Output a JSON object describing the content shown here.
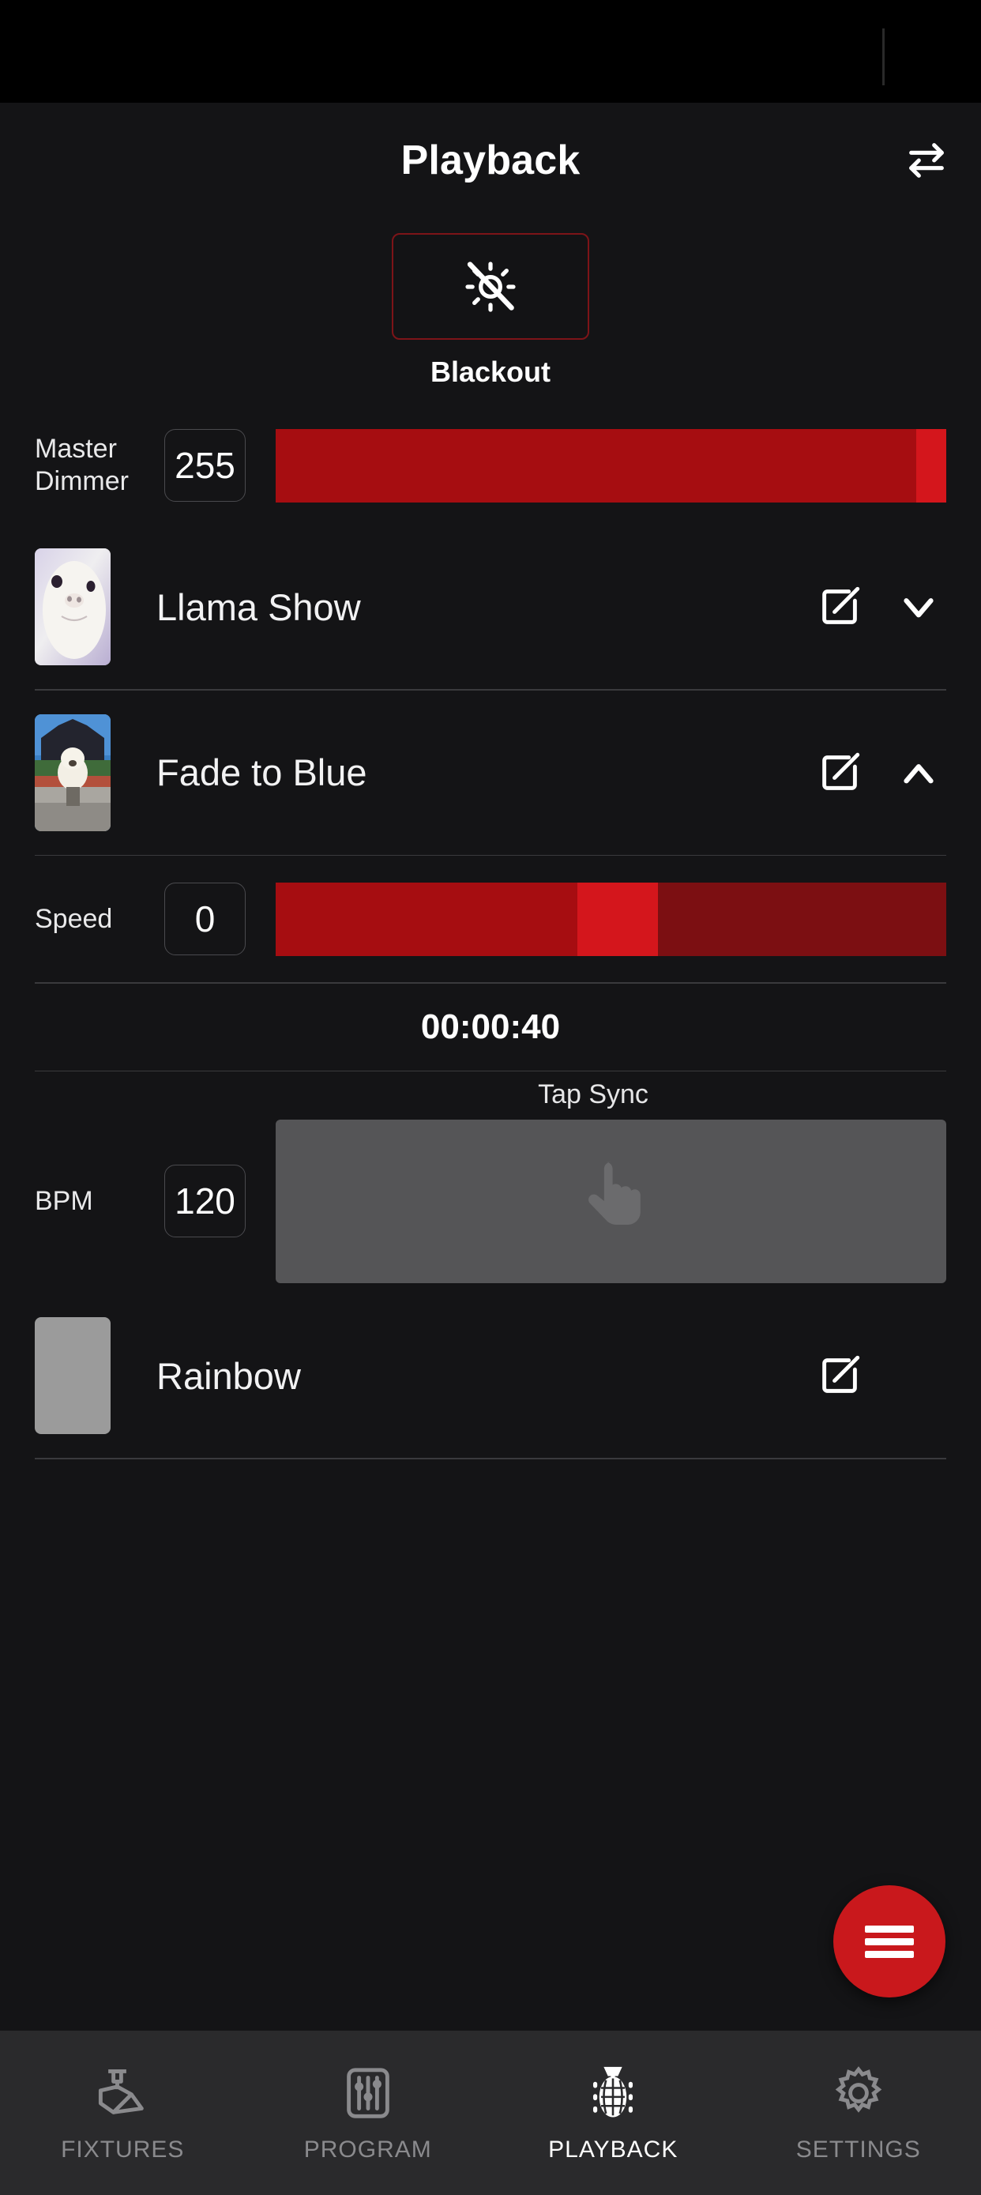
{
  "header": {
    "title": "Playback",
    "swap_icon": "swap-horizontal-icon"
  },
  "blackout": {
    "label": "Blackout",
    "icon": "sun-off-icon",
    "border_color": "#7d1418"
  },
  "master_dimmer": {
    "label": "Master\nDimmer",
    "label_line1": "Master",
    "label_line2": "Dimmer",
    "value": "255",
    "fill_percent": 95.5,
    "thumb_percent": 95.5,
    "fill_color": "#a60d11",
    "thumb_color": "#d4161c",
    "track_color": "#7c0f12"
  },
  "scenes": [
    {
      "name": "Llama Show",
      "edit_icon": "edit-pencil-icon",
      "chevron": "chevron-down-icon",
      "thumbnail": "llama-face-thumbnail"
    },
    {
      "name": "Fade to Blue",
      "edit_icon": "edit-pencil-icon",
      "chevron": "chevron-up-icon",
      "thumbnail": "dog-building-thumbnail"
    }
  ],
  "speed": {
    "label": "Speed",
    "value": "0",
    "fill_percent": 45.0,
    "thumb_percent": 45.0,
    "thumb_width_percent": 12.0
  },
  "timer": {
    "value": "00:00:40"
  },
  "bpm": {
    "label": "BPM",
    "value": "120",
    "tap_sync_label": "Tap Sync",
    "tap_icon": "tap-finger-icon",
    "tap_button_color": "#555557"
  },
  "rainbow_scene": {
    "name": "Rainbow",
    "edit_icon": "edit-pencil-icon",
    "thumbnail": "gray-swatch-thumbnail"
  },
  "fab": {
    "icon": "hamburger-menu-icon",
    "color": "#c9181c"
  },
  "bottom_nav": {
    "items": [
      {
        "label": "FIXTURES",
        "icon": "moving-head-light-icon",
        "active": false
      },
      {
        "label": "PROGRAM",
        "icon": "sliders-icon",
        "active": false
      },
      {
        "label": "PLAYBACK",
        "icon": "disco-ball-icon",
        "active": true
      },
      {
        "label": "SETTINGS",
        "icon": "gear-icon",
        "active": false
      }
    ]
  }
}
